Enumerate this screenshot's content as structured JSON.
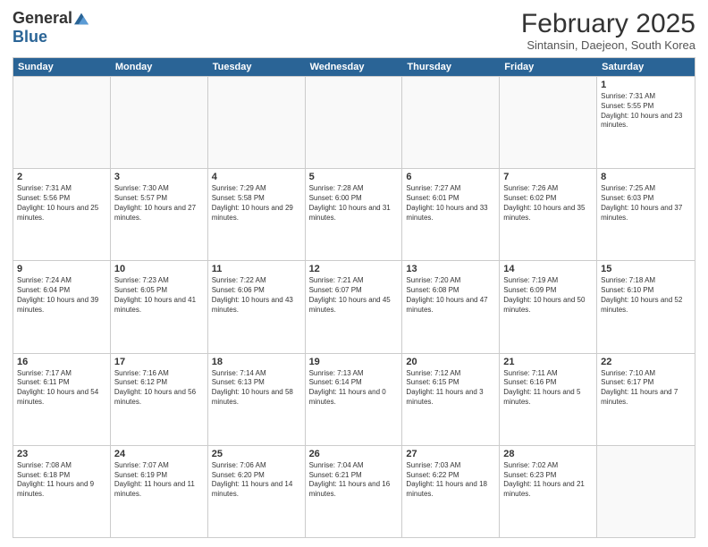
{
  "logo": {
    "general": "General",
    "blue": "Blue"
  },
  "header": {
    "title": "February 2025",
    "subtitle": "Sintansin, Daejeon, South Korea"
  },
  "dayHeaders": [
    "Sunday",
    "Monday",
    "Tuesday",
    "Wednesday",
    "Thursday",
    "Friday",
    "Saturday"
  ],
  "weeks": [
    [
      {
        "num": "",
        "info": ""
      },
      {
        "num": "",
        "info": ""
      },
      {
        "num": "",
        "info": ""
      },
      {
        "num": "",
        "info": ""
      },
      {
        "num": "",
        "info": ""
      },
      {
        "num": "",
        "info": ""
      },
      {
        "num": "1",
        "info": "Sunrise: 7:31 AM\nSunset: 5:55 PM\nDaylight: 10 hours and 23 minutes."
      }
    ],
    [
      {
        "num": "2",
        "info": "Sunrise: 7:31 AM\nSunset: 5:56 PM\nDaylight: 10 hours and 25 minutes."
      },
      {
        "num": "3",
        "info": "Sunrise: 7:30 AM\nSunset: 5:57 PM\nDaylight: 10 hours and 27 minutes."
      },
      {
        "num": "4",
        "info": "Sunrise: 7:29 AM\nSunset: 5:58 PM\nDaylight: 10 hours and 29 minutes."
      },
      {
        "num": "5",
        "info": "Sunrise: 7:28 AM\nSunset: 6:00 PM\nDaylight: 10 hours and 31 minutes."
      },
      {
        "num": "6",
        "info": "Sunrise: 7:27 AM\nSunset: 6:01 PM\nDaylight: 10 hours and 33 minutes."
      },
      {
        "num": "7",
        "info": "Sunrise: 7:26 AM\nSunset: 6:02 PM\nDaylight: 10 hours and 35 minutes."
      },
      {
        "num": "8",
        "info": "Sunrise: 7:25 AM\nSunset: 6:03 PM\nDaylight: 10 hours and 37 minutes."
      }
    ],
    [
      {
        "num": "9",
        "info": "Sunrise: 7:24 AM\nSunset: 6:04 PM\nDaylight: 10 hours and 39 minutes."
      },
      {
        "num": "10",
        "info": "Sunrise: 7:23 AM\nSunset: 6:05 PM\nDaylight: 10 hours and 41 minutes."
      },
      {
        "num": "11",
        "info": "Sunrise: 7:22 AM\nSunset: 6:06 PM\nDaylight: 10 hours and 43 minutes."
      },
      {
        "num": "12",
        "info": "Sunrise: 7:21 AM\nSunset: 6:07 PM\nDaylight: 10 hours and 45 minutes."
      },
      {
        "num": "13",
        "info": "Sunrise: 7:20 AM\nSunset: 6:08 PM\nDaylight: 10 hours and 47 minutes."
      },
      {
        "num": "14",
        "info": "Sunrise: 7:19 AM\nSunset: 6:09 PM\nDaylight: 10 hours and 50 minutes."
      },
      {
        "num": "15",
        "info": "Sunrise: 7:18 AM\nSunset: 6:10 PM\nDaylight: 10 hours and 52 minutes."
      }
    ],
    [
      {
        "num": "16",
        "info": "Sunrise: 7:17 AM\nSunset: 6:11 PM\nDaylight: 10 hours and 54 minutes."
      },
      {
        "num": "17",
        "info": "Sunrise: 7:16 AM\nSunset: 6:12 PM\nDaylight: 10 hours and 56 minutes."
      },
      {
        "num": "18",
        "info": "Sunrise: 7:14 AM\nSunset: 6:13 PM\nDaylight: 10 hours and 58 minutes."
      },
      {
        "num": "19",
        "info": "Sunrise: 7:13 AM\nSunset: 6:14 PM\nDaylight: 11 hours and 0 minutes."
      },
      {
        "num": "20",
        "info": "Sunrise: 7:12 AM\nSunset: 6:15 PM\nDaylight: 11 hours and 3 minutes."
      },
      {
        "num": "21",
        "info": "Sunrise: 7:11 AM\nSunset: 6:16 PM\nDaylight: 11 hours and 5 minutes."
      },
      {
        "num": "22",
        "info": "Sunrise: 7:10 AM\nSunset: 6:17 PM\nDaylight: 11 hours and 7 minutes."
      }
    ],
    [
      {
        "num": "23",
        "info": "Sunrise: 7:08 AM\nSunset: 6:18 PM\nDaylight: 11 hours and 9 minutes."
      },
      {
        "num": "24",
        "info": "Sunrise: 7:07 AM\nSunset: 6:19 PM\nDaylight: 11 hours and 11 minutes."
      },
      {
        "num": "25",
        "info": "Sunrise: 7:06 AM\nSunset: 6:20 PM\nDaylight: 11 hours and 14 minutes."
      },
      {
        "num": "26",
        "info": "Sunrise: 7:04 AM\nSunset: 6:21 PM\nDaylight: 11 hours and 16 minutes."
      },
      {
        "num": "27",
        "info": "Sunrise: 7:03 AM\nSunset: 6:22 PM\nDaylight: 11 hours and 18 minutes."
      },
      {
        "num": "28",
        "info": "Sunrise: 7:02 AM\nSunset: 6:23 PM\nDaylight: 11 hours and 21 minutes."
      },
      {
        "num": "",
        "info": ""
      }
    ]
  ]
}
